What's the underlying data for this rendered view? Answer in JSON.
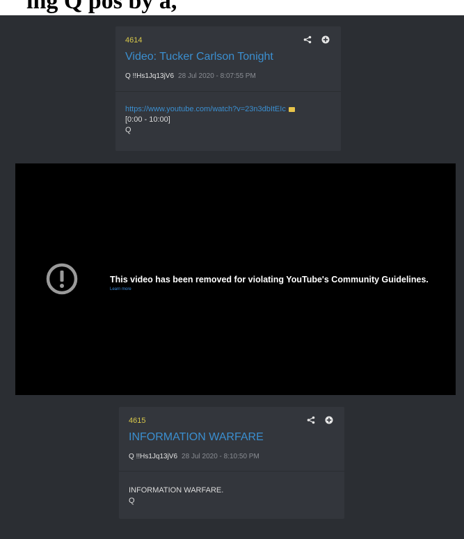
{
  "page": {
    "header_fragment": "ing Q pos        by        a,"
  },
  "posts": [
    {
      "number": "4614",
      "title": "Video: Tucker Carlson Tonight",
      "author": "Q",
      "tripcode": "!!Hs1Jq13jV6",
      "timestamp": "28 Jul 2020 - 8:07:55 PM",
      "body": {
        "link": "https://www.youtube.com/watch?v=23n3dbItEIc",
        "line2": "[0:00 - 10:00]",
        "line3": "Q"
      },
      "actions": [
        "share-icon",
        "plus-circle-icon"
      ]
    },
    {
      "number": "4615",
      "title": "INFORMATION WARFARE",
      "author": "Q",
      "tripcode": "!!Hs1Jq13jV6",
      "timestamp": "28 Jul 2020 - 8:10:50 PM",
      "body": {
        "line1": "INFORMATION WARFARE.",
        "line2": "Q"
      },
      "actions": [
        "share-icon",
        "plus-circle-icon"
      ]
    }
  ],
  "video": {
    "message": "This video has been removed for violating YouTube's Community Guidelines.",
    "learn_more": "Learn more",
    "icon": "alert-circle-icon"
  },
  "colors": {
    "background": "#2b2e33",
    "card": "#33363c",
    "number": "#d8c84a",
    "title": "#3b8fd0",
    "video_bg": "#000000"
  }
}
